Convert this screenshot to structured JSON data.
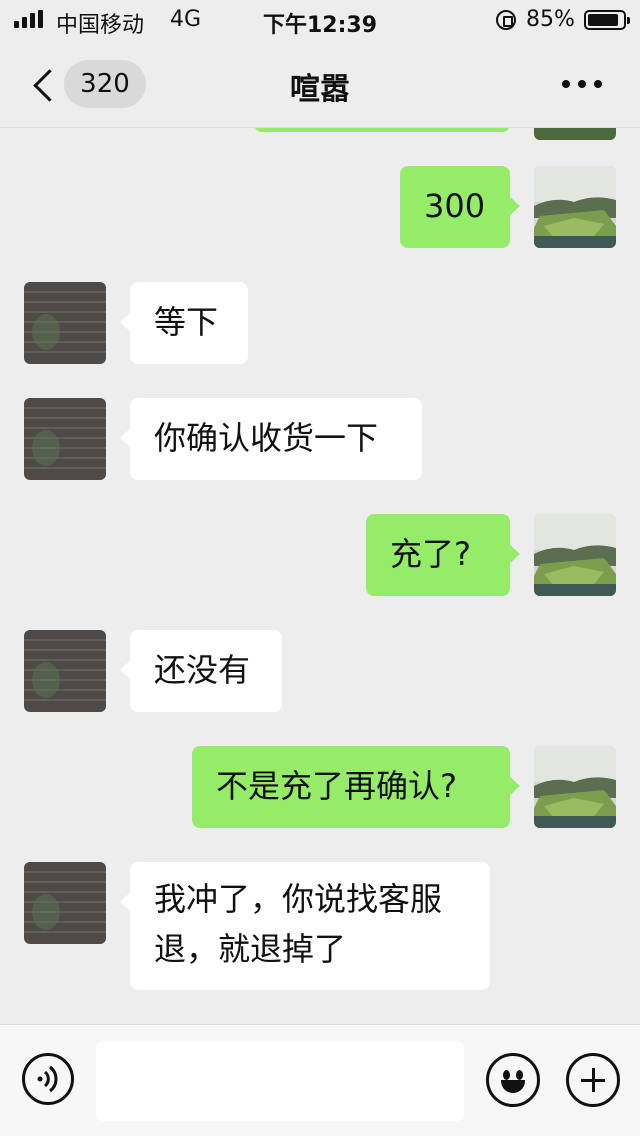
{
  "status_bar": {
    "carrier": "中国移动",
    "network": "4G",
    "time": "下午12:39",
    "battery_percent": "85%",
    "battery_level": 0.85
  },
  "nav": {
    "back_icon": "chevron-left-icon",
    "unread_count": "320",
    "title": "喧嚣",
    "more_icon": "more-dots-icon"
  },
  "messages": [
    {
      "sender": "me",
      "text": "300"
    },
    {
      "sender": "them",
      "text": "等下"
    },
    {
      "sender": "them",
      "text": "你确认收货一下"
    },
    {
      "sender": "me",
      "text": "充了?"
    },
    {
      "sender": "them",
      "text": "还没有"
    },
    {
      "sender": "me",
      "text": "不是充了再确认?"
    },
    {
      "sender": "them",
      "text": "我冲了，你说找客服退，就退掉了"
    }
  ],
  "input_bar": {
    "voice_icon": "voice-icon",
    "emoji_icon": "emoji-icon",
    "add_icon": "plus-icon",
    "placeholder": ""
  },
  "colors": {
    "background": "#ededed",
    "my_bubble": "#95ec69",
    "their_bubble": "#ffffff"
  }
}
